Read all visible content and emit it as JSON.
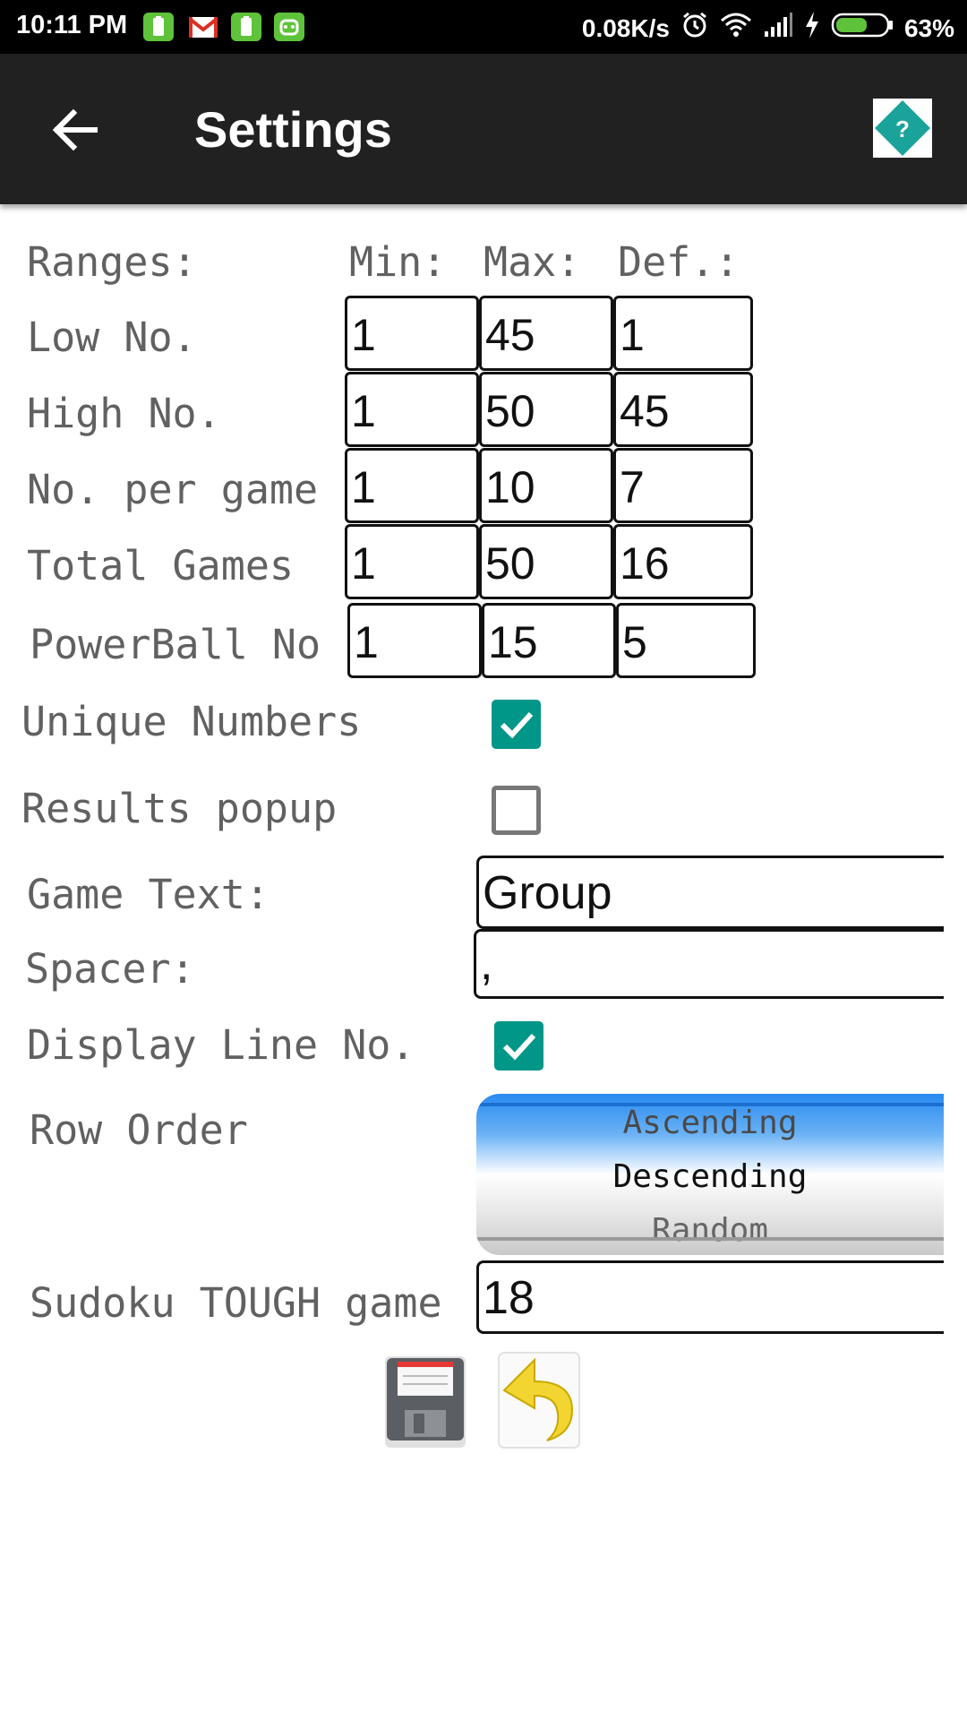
{
  "status_bar": {
    "time": "10:11 PM",
    "net_speed": "0.08K/s",
    "battery_pct": "63%",
    "notification_icons": [
      "battery-notif-icon",
      "gmail-icon",
      "battery-notif-icon",
      "android-icon"
    ],
    "battery_level": 0.63
  },
  "app_bar": {
    "title": "Settings",
    "help_label": "?"
  },
  "ranges": {
    "header_label": "Ranges:",
    "col_min": "Min:",
    "col_max": "Max:",
    "col_def": "Def.:",
    "rows": [
      {
        "label": "Low No.",
        "min": "1",
        "max": "45",
        "def": "1"
      },
      {
        "label": "High No.",
        "min": "1",
        "max": "50",
        "def": "45"
      },
      {
        "label": "No. per game",
        "min": "1",
        "max": "10",
        "def": "7"
      },
      {
        "label": "Total Games",
        "min": "1",
        "max": "50",
        "def": "16"
      },
      {
        "label": "PowerBall No",
        "min": "1",
        "max": "15",
        "def": "5"
      }
    ]
  },
  "options": {
    "unique_numbers_label": "Unique Numbers",
    "unique_numbers_checked": true,
    "results_popup_label": "Results popup",
    "results_popup_checked": false,
    "game_text_label": "Game Text:",
    "game_text_value": "Group",
    "spacer_label": "Spacer:",
    "spacer_value": ",",
    "display_line_label": "Display Line No.",
    "display_line_checked": true,
    "row_order_label": "Row Order",
    "row_order_options": [
      "Ascending",
      "Descending",
      "Random"
    ],
    "row_order_selected": "Descending",
    "sudoku_label": "Sudoku TOUGH game",
    "sudoku_value": "18"
  },
  "colors": {
    "checkbox": "#009688",
    "app_bar": "#212121",
    "label_text": "#616161",
    "help_diamond": "#1aa39a"
  }
}
